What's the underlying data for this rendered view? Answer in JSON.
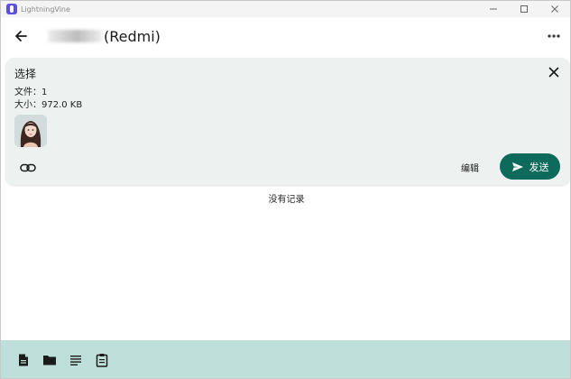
{
  "window": {
    "app_title": "LightningVine",
    "controls": {
      "minimize_icon": "minimize-icon",
      "maximize_icon": "maximize-icon",
      "close_icon": "close-icon"
    }
  },
  "header": {
    "device_name_suffix": "(Redmi)",
    "back_icon": "arrow-left-icon",
    "more_icon": "more-horizontal-icon"
  },
  "selection": {
    "title": "选择",
    "files_line": "文件：1",
    "size_line": "大小：972.0 KB",
    "edit_label": "编辑",
    "send_label": "发送",
    "link_icon": "link-icon",
    "send_icon": "send-icon",
    "close_icon": "close-icon"
  },
  "history": {
    "empty_text": "没有记录"
  },
  "bottom_bar": {
    "items": [
      {
        "icon": "file-icon"
      },
      {
        "icon": "folder-icon"
      },
      {
        "icon": "text-icon"
      },
      {
        "icon": "clipboard-icon"
      }
    ]
  },
  "colors": {
    "accent": "#0e6b5b",
    "card_bg": "#edf2f0",
    "bottom_bar_bg": "#bfe0da",
    "logo": "#5b4ee6"
  }
}
